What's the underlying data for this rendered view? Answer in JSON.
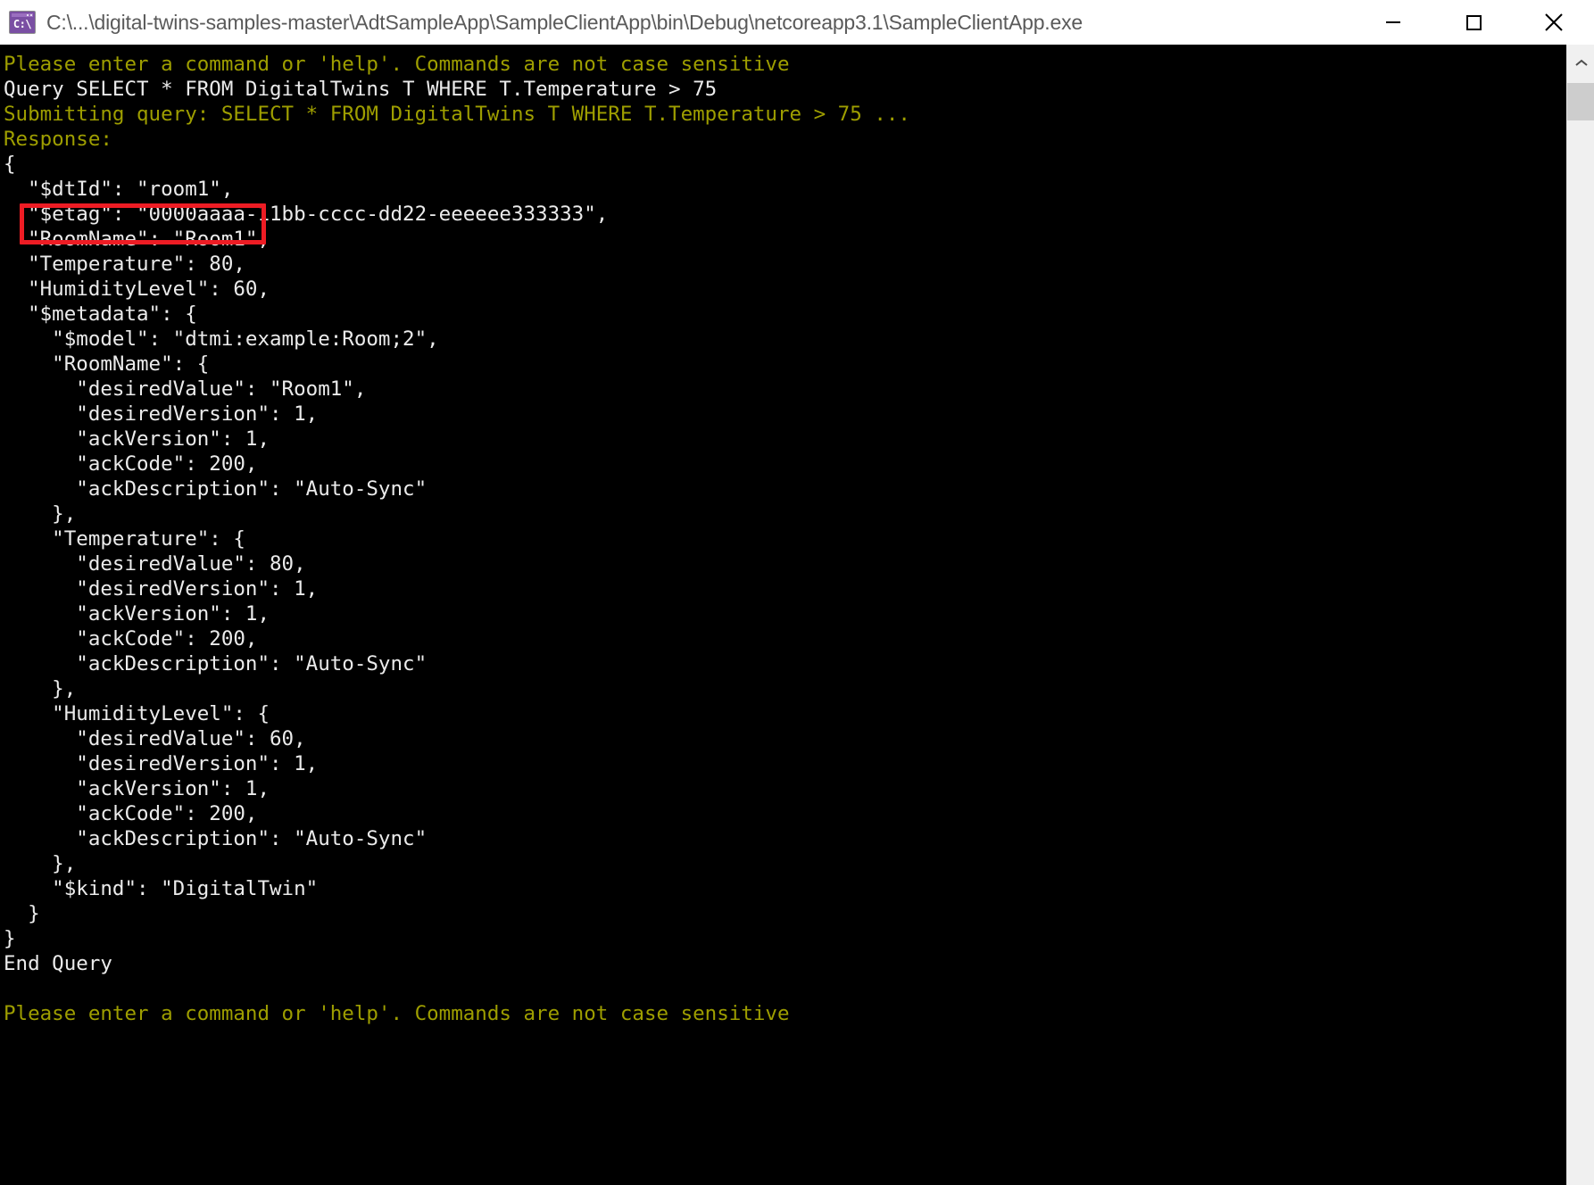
{
  "window": {
    "title": "C:\\...\\digital-twins-samples-master\\AdtSampleApp\\SampleClientApp\\bin\\Debug\\netcoreapp3.1\\SampleClientApp.exe",
    "app_icon_label": "C:\\",
    "controls": {
      "minimize": "–",
      "maximize": "□",
      "close": "×",
      "minimize_name": "Minimize",
      "maximize_name": "Maximize",
      "close_name": "Close"
    }
  },
  "console": {
    "background_color": "#000000",
    "prompt_color": "#9e9e00",
    "text_color": "#ebebeb",
    "highlight_color": "#ed1c24",
    "lines": [
      {
        "text": "Please enter a command or 'help'. Commands are not case sensitive",
        "style": "prompt"
      },
      {
        "text": "Query SELECT * FROM DigitalTwins T WHERE T.Temperature > 75",
        "style": "white"
      },
      {
        "text": "Submitting query: SELECT * FROM DigitalTwins T WHERE T.Temperature > 75 ...",
        "style": "prompt"
      },
      {
        "text": "Response:",
        "style": "prompt"
      },
      {
        "text": "{",
        "style": "white"
      },
      {
        "text": "  \"$dtId\": \"room1\",",
        "style": "white"
      },
      {
        "text": "  \"$etag\": \"0000aaaa-11bb-cccc-dd22-eeeeee333333\",",
        "style": "white"
      },
      {
        "text": "  \"RoomName\": \"Room1\",",
        "style": "white"
      },
      {
        "text": "  \"Temperature\": 80,",
        "style": "white"
      },
      {
        "text": "  \"HumidityLevel\": 60,",
        "style": "white"
      },
      {
        "text": "  \"$metadata\": {",
        "style": "white"
      },
      {
        "text": "    \"$model\": \"dtmi:example:Room;2\",",
        "style": "white"
      },
      {
        "text": "    \"RoomName\": {",
        "style": "white"
      },
      {
        "text": "      \"desiredValue\": \"Room1\",",
        "style": "white"
      },
      {
        "text": "      \"desiredVersion\": 1,",
        "style": "white"
      },
      {
        "text": "      \"ackVersion\": 1,",
        "style": "white"
      },
      {
        "text": "      \"ackCode\": 200,",
        "style": "white"
      },
      {
        "text": "      \"ackDescription\": \"Auto-Sync\"",
        "style": "white"
      },
      {
        "text": "    },",
        "style": "white"
      },
      {
        "text": "    \"Temperature\": {",
        "style": "white"
      },
      {
        "text": "      \"desiredValue\": 80,",
        "style": "white"
      },
      {
        "text": "      \"desiredVersion\": 1,",
        "style": "white"
      },
      {
        "text": "      \"ackVersion\": 1,",
        "style": "white"
      },
      {
        "text": "      \"ackCode\": 200,",
        "style": "white"
      },
      {
        "text": "      \"ackDescription\": \"Auto-Sync\"",
        "style": "white"
      },
      {
        "text": "    },",
        "style": "white"
      },
      {
        "text": "    \"HumidityLevel\": {",
        "style": "white"
      },
      {
        "text": "      \"desiredValue\": 60,",
        "style": "white"
      },
      {
        "text": "      \"desiredVersion\": 1,",
        "style": "white"
      },
      {
        "text": "      \"ackVersion\": 1,",
        "style": "white"
      },
      {
        "text": "      \"ackCode\": 200,",
        "style": "white"
      },
      {
        "text": "      \"ackDescription\": \"Auto-Sync\"",
        "style": "white"
      },
      {
        "text": "    },",
        "style": "white"
      },
      {
        "text": "    \"$kind\": \"DigitalTwin\"",
        "style": "white"
      },
      {
        "text": "  }",
        "style": "white"
      },
      {
        "text": "}",
        "style": "white"
      },
      {
        "text": "End Query",
        "style": "white"
      },
      {
        "text": "",
        "style": "white"
      },
      {
        "text": "Please enter a command or 'help'. Commands are not case sensitive",
        "style": "prompt"
      }
    ]
  },
  "annotation": {
    "highlighted_line": "\"$dtId\": \"room1\","
  },
  "scrollbar": {
    "up_arrow": "⌃"
  }
}
